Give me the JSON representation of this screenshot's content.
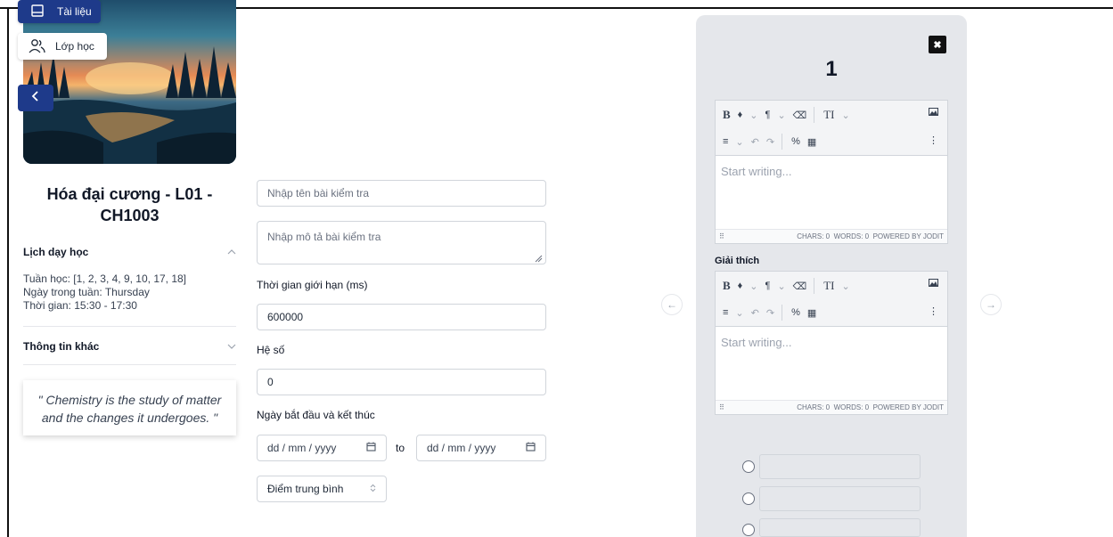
{
  "sidebar": {
    "tai_lieu_label": "Tài liệu",
    "lop_hoc_label": "Lớp học",
    "back_icon": "chevron-left-icon",
    "course_title": "Hóa đại cương - L01 - CH1003",
    "schedule_header": "Lịch dạy học",
    "schedule": {
      "weeks": "Tuần học: [1, 2, 3, 4, 9, 10, 17, 18]",
      "weekday": "Ngày trong tuần: Thursday",
      "time": "Thời gian: 15:30 - 17:30"
    },
    "other_info_header": "Thông tin khác",
    "quote": "\" Chemistry is the study of matter and the changes it undergoes. \""
  },
  "form": {
    "name_placeholder": "Nhập tên bài kiểm tra",
    "desc_placeholder": "Nhập mô tả bài kiểm tra",
    "time_limit_label": "Thời gian giới hạn (ms)",
    "time_limit_value": "600000",
    "coefficient_label": "Hệ số",
    "coefficient_value": "0",
    "date_range_label": "Ngày bắt đầu và kết thúc",
    "start_date_placeholder": "dd / mm / yyyy",
    "to_label": "to",
    "end_date_placeholder": "dd / mm / yyyy",
    "grading_select": "Điểm trung bình"
  },
  "question_panel": {
    "number": "1",
    "editor_placeholder": "Start writing...",
    "status_chars": "CHARS: 0",
    "status_words": "WORDS: 0",
    "status_powered": "POWERED BY JODIT",
    "explanation_label": "Giải thích",
    "option_count": 3
  },
  "colors": {
    "primary": "#1e3a8a",
    "panel_bg": "#e5e7eb",
    "border": "#d1d5db"
  }
}
